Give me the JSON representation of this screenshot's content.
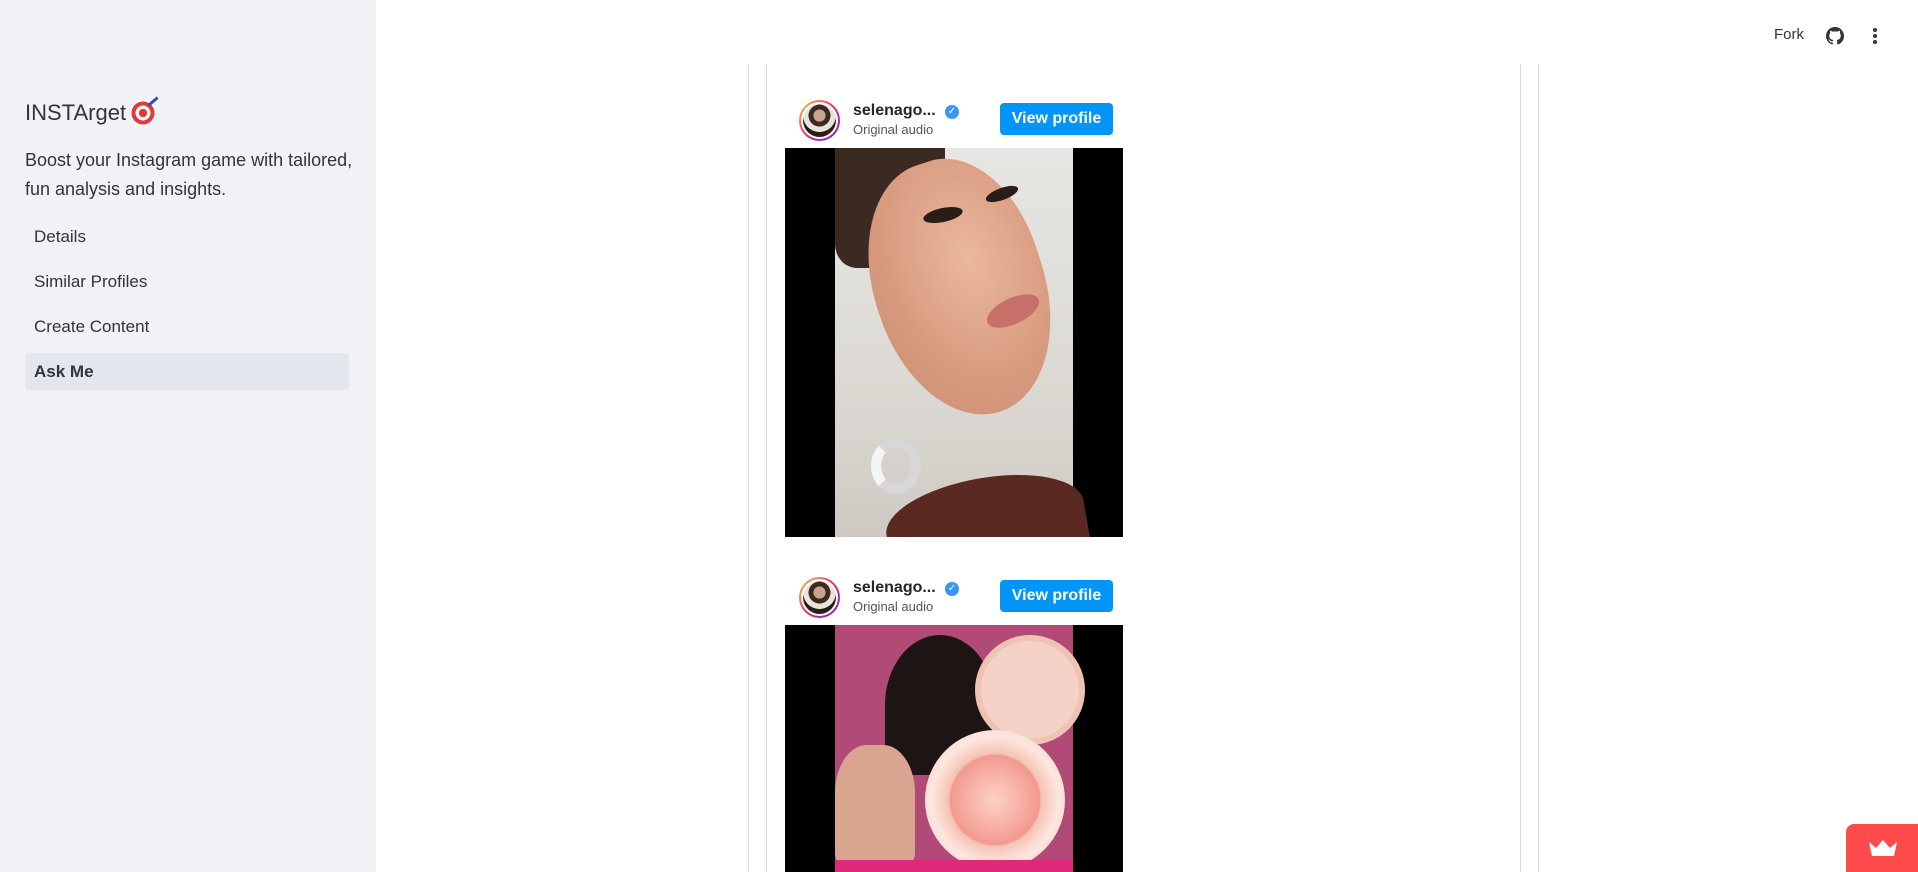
{
  "sidebar": {
    "title": "INSTArget",
    "title_emoji": "🎯",
    "tagline": "Boost your Instagram game with tailored, fun analysis and insights.",
    "nav": [
      {
        "label": "Details",
        "active": false
      },
      {
        "label": "Similar Profiles",
        "active": false
      },
      {
        "label": "Create Content",
        "active": false
      },
      {
        "label": "Ask Me",
        "active": true
      }
    ]
  },
  "toolbar": {
    "fork_label": "Fork",
    "github_icon": "github-icon",
    "menu_icon": "kebab-menu-icon"
  },
  "posts": [
    {
      "username": "selenago...",
      "audio": "Original audio",
      "button": "View profile",
      "media": "portrait-video"
    },
    {
      "username": "selenago...",
      "audio": "Original audio",
      "button": "View profile",
      "media": "compact-video"
    }
  ],
  "colors": {
    "sidebar_bg": "#f0f2f6",
    "active_item_bg": "#e3e6ec",
    "primary_button": "#0095f6",
    "badge": "#ff4b4b"
  }
}
